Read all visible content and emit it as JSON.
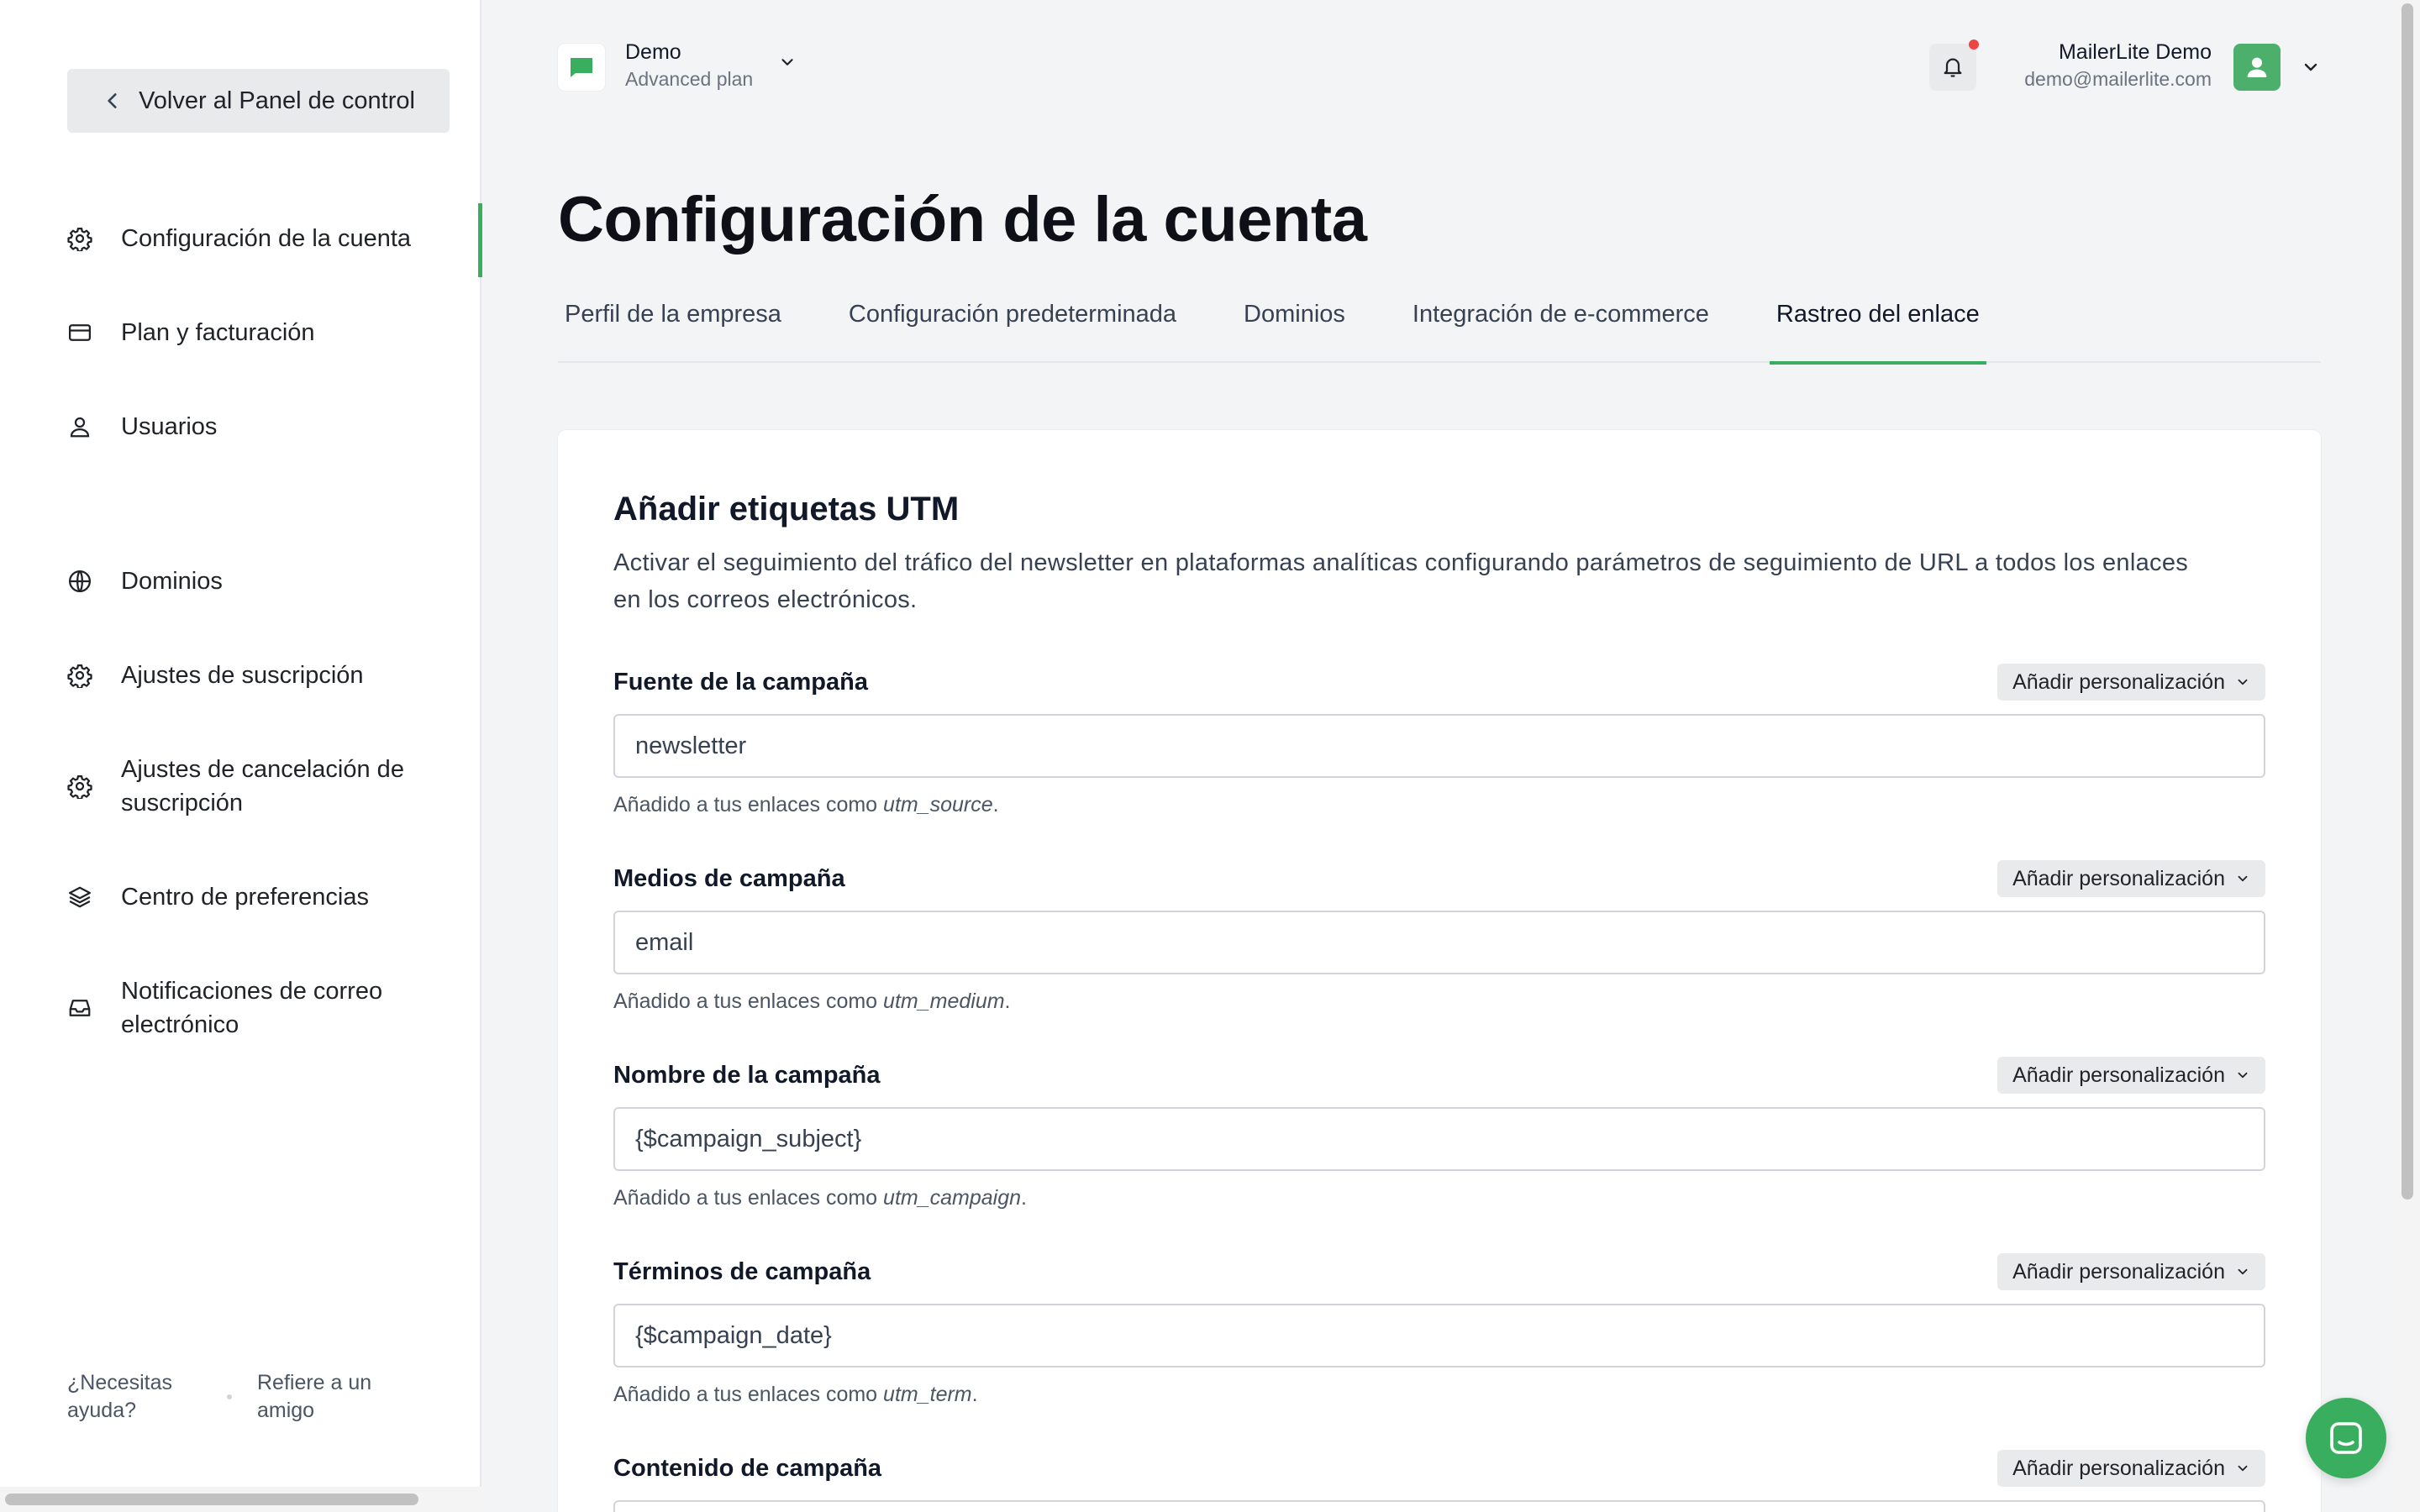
{
  "sidebar": {
    "back_label": "Volver al Panel de control",
    "items": [
      {
        "label": "Configuración de la cuenta",
        "icon": "gear-icon",
        "active": true
      },
      {
        "label": "Plan y facturación",
        "icon": "credit-card-icon"
      },
      {
        "label": "Usuarios",
        "icon": "user-icon"
      },
      {
        "label": "Dominios",
        "icon": "globe-icon"
      },
      {
        "label": "Ajustes de suscripción",
        "icon": "gear-icon"
      },
      {
        "label": "Ajustes de cancelación de suscripción",
        "icon": "gear-icon"
      },
      {
        "label": "Centro de preferencias",
        "icon": "layers-icon"
      },
      {
        "label": "Notificaciones de correo electrónico",
        "icon": "inbox-icon"
      }
    ],
    "footer": {
      "help": "¿Necesitas ayuda?",
      "refer": "Refiere a un amigo"
    }
  },
  "header": {
    "account_name": "Demo",
    "account_plan": "Advanced plan",
    "user_name": "MailerLite Demo",
    "user_email": "demo@mailerlite.com"
  },
  "page": {
    "title": "Configuración de la cuenta",
    "tabs": [
      {
        "label": "Perfil de la empresa"
      },
      {
        "label": "Configuración predeterminada"
      },
      {
        "label": "Dominios"
      },
      {
        "label": "Integración de e-commerce"
      },
      {
        "label": "Rastreo del enlace",
        "active": true
      }
    ]
  },
  "card": {
    "title": "Añadir etiquetas UTM",
    "description": "Activar el seguimiento del tráfico del newsletter en plataformas analíticas configurando parámetros de seguimiento de URL a todos los enlaces en los correos electrónicos.",
    "personalization_label": "Añadir personalización",
    "hint_prefix": "Añadido a tus enlaces como",
    "fields": [
      {
        "label": "Fuente de la campaña",
        "value": "newsletter",
        "param": "utm_source"
      },
      {
        "label": "Medios de campaña",
        "value": "email",
        "param": "utm_medium"
      },
      {
        "label": "Nombre de la campaña",
        "value": "{$campaign_subject}",
        "param": "utm_campaign"
      },
      {
        "label": "Términos de campaña",
        "value": "{$campaign_date}",
        "param": "utm_term"
      },
      {
        "label": "Contenido de campaña",
        "value": "",
        "param": ""
      }
    ]
  },
  "colors": {
    "accent": "#3aae5f",
    "notification": "#ef4444"
  }
}
